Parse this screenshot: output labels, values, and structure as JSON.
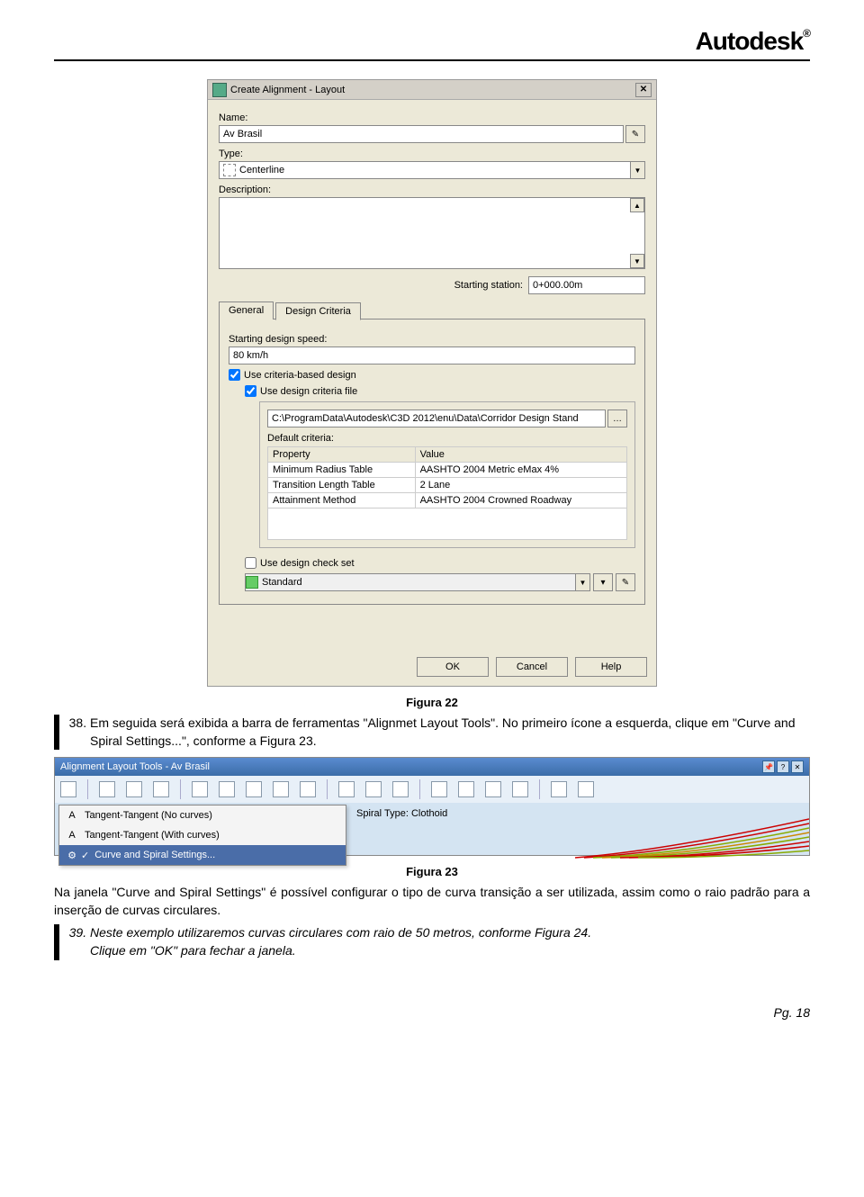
{
  "logo": "Autodesk",
  "dialog": {
    "title": "Create Alignment - Layout",
    "name_label": "Name:",
    "name_value": "Av Brasil",
    "type_label": "Type:",
    "type_value": "Centerline",
    "desc_label": "Description:",
    "station_label": "Starting station:",
    "station_value": "0+000.00m",
    "tabs": {
      "general": "General",
      "criteria": "Design Criteria"
    },
    "speed_label": "Starting design speed:",
    "speed_value": "80 km/h",
    "use_criteria": "Use criteria-based design",
    "use_file": "Use design criteria file",
    "file_path": "C:\\ProgramData\\Autodesk\\C3D 2012\\enu\\Data\\Corridor Design Stand",
    "default_criteria": "Default criteria:",
    "table": {
      "h1": "Property",
      "h2": "Value",
      "rows": [
        {
          "p": "Minimum Radius Table",
          "v": "AASHTO 2004 Metric eMax 4%"
        },
        {
          "p": "Transition Length Table",
          "v": "2 Lane"
        },
        {
          "p": "Attainment Method",
          "v": "AASHTO 2004 Crowned Roadway"
        }
      ]
    },
    "use_checkset": "Use design check set",
    "checkset_value": "Standard",
    "ok": "OK",
    "cancel": "Cancel",
    "help": "Help"
  },
  "caption1": "Figura 22",
  "step38": "Em seguida será exibida a barra de ferramentas \"Alignmet Layout Tools\". No primeiro ícone a esquerda, clique em \"Curve and Spiral Settings...\", conforme a Figura 23.",
  "toolbar": {
    "title": "Alignment Layout Tools - Av Brasil",
    "menu": {
      "i1": "Tangent-Tangent (No curves)",
      "i2": "Tangent-Tangent (With curves)",
      "i3": "Curve and Spiral Settings..."
    },
    "spiral": "Spiral Type: Clothoid"
  },
  "caption2": "Figura 23",
  "body2": "Na janela \"Curve and Spiral Settings\" é possível configurar o tipo de curva transição a ser utilizada, assim como o raio padrão para a inserção de curvas circulares.",
  "step39a": "Neste exemplo utilizaremos curvas circulares  com raio de 50 metros, conforme Figura 24.",
  "step39b": "Clique em \"OK\" para fechar a janela.",
  "footer": "Pg. 18"
}
